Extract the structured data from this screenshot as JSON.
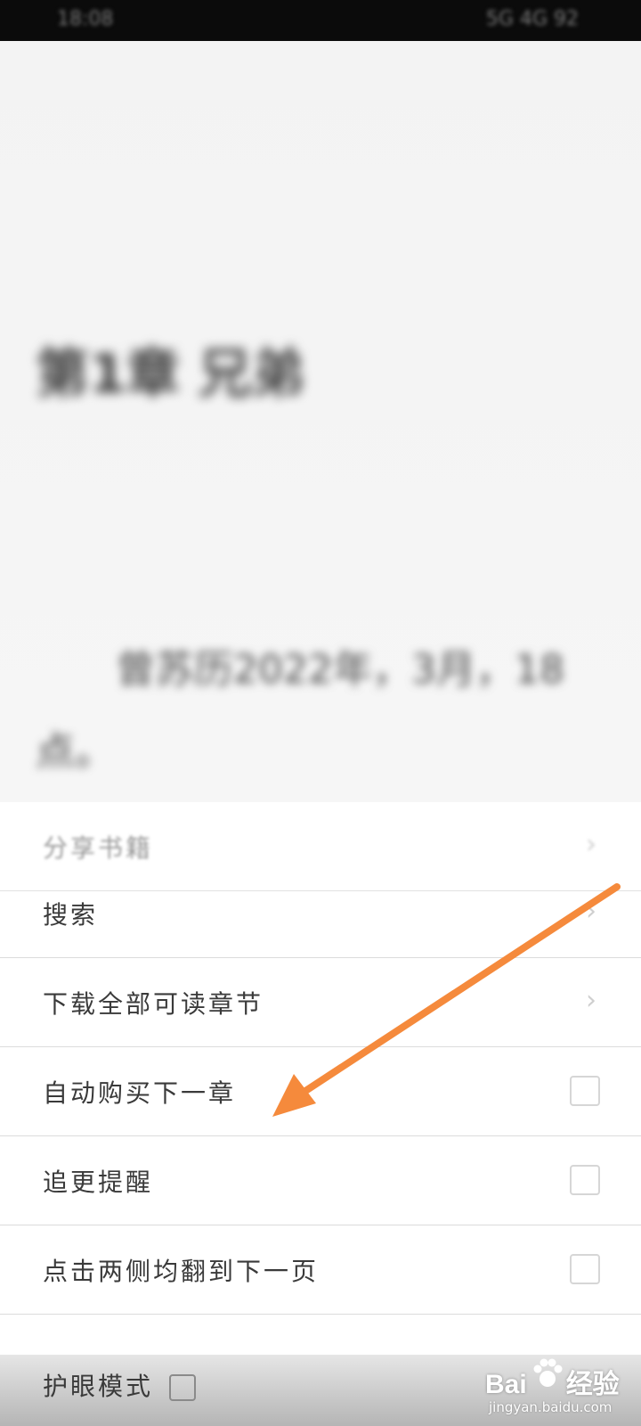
{
  "status_bar": {
    "time": "18:08",
    "indicators": "5G 4G 92"
  },
  "reader": {
    "chapter_title": "第1章 兄弟",
    "body_text": "曾苏历2022年，3月，18点。"
  },
  "menu": {
    "items": [
      {
        "label": "分享书籍",
        "control": "chevron"
      },
      {
        "label": "搜索",
        "control": "chevron"
      },
      {
        "label": "下载全部可读章节",
        "control": "chevron"
      },
      {
        "label": "自动购买下一章",
        "control": "checkbox",
        "checked": false
      },
      {
        "label": "追更提醒",
        "control": "checkbox",
        "checked": false
      },
      {
        "label": "点击两侧均翻到下一页",
        "control": "checkbox",
        "checked": false
      }
    ],
    "bottom": {
      "label": "护眼模式",
      "checked": false
    }
  },
  "annotation": {
    "arrow_color": "#f58a3c"
  },
  "watermark": {
    "brand_left": "Bai",
    "brand_right": "经验",
    "url": "jingyan.baidu.com"
  }
}
